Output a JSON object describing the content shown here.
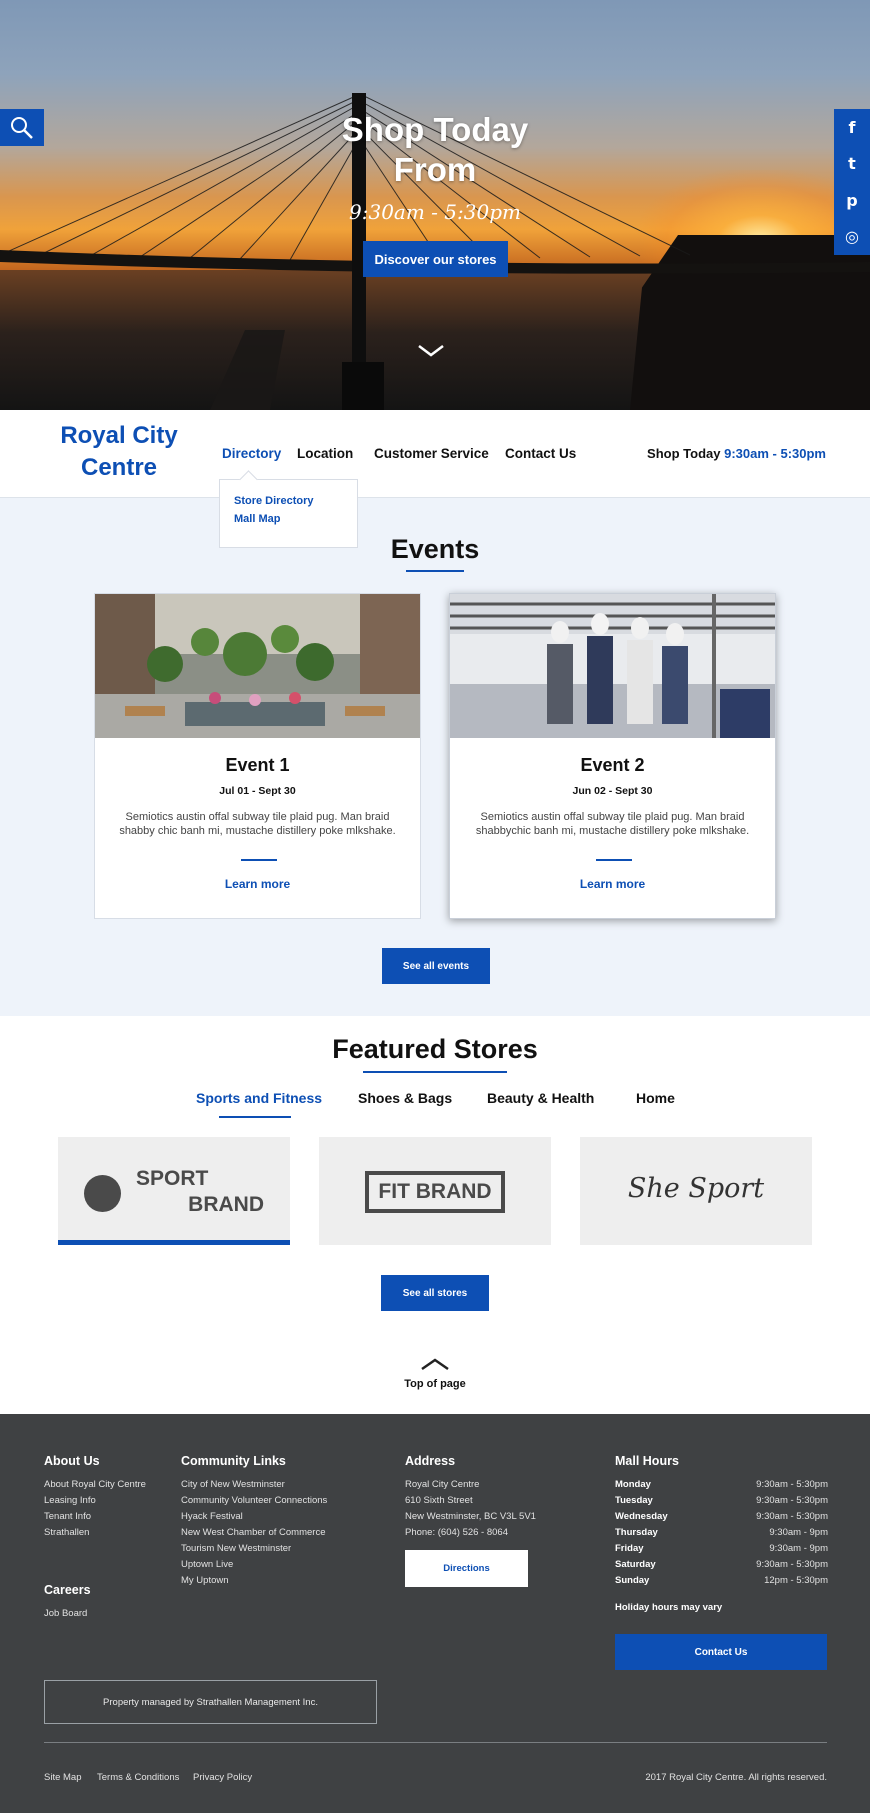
{
  "hero": {
    "title_line1": "Shop Today",
    "title_line2": "From",
    "hours": "9:30am - 5:30pm",
    "cta": "Discover our stores"
  },
  "icons": {
    "search": "search-icon",
    "social": [
      "facebook-icon",
      "twitter-icon",
      "pinterest-icon",
      "instagram-icon"
    ],
    "scroll_down": "chevron-down-icon",
    "top": "chevron-up-icon"
  },
  "social_glyphs": [
    "f",
    "t",
    "p",
    "◎"
  ],
  "header": {
    "logo_line1": "Royal City",
    "logo_line2": "Centre",
    "nav": [
      "Directory",
      "Location",
      "Customer Service",
      "Contact Us"
    ],
    "shop_label": "Shop Today",
    "shop_hours": "9:30am - 5:30pm",
    "dropdown": [
      "Store Directory",
      "Mall Map"
    ]
  },
  "events": {
    "title": "Events",
    "items": [
      {
        "name": "Event 1",
        "date": "Jul 01 - Sept 30",
        "desc": "Semiotics austin offal subway tile plaid pug. Man braid shabby chic banh mi, mustache distillery poke mlkshake.",
        "link": "Learn more"
      },
      {
        "name": "Event 2",
        "date": "Jun 02 - Sept 30",
        "desc": "Semiotics austin offal subway tile plaid pug. Man braid shabbychic banh mi, mustache distillery poke mlkshake.",
        "link": "Learn more"
      }
    ],
    "all_button": "See all events"
  },
  "featured": {
    "title": "Featured Stores",
    "tabs": [
      "Sports and Fitness",
      "Shoes & Bags",
      "Beauty & Health",
      "Home"
    ],
    "stores": [
      {
        "line1": "SPORT",
        "line2": "BRAND"
      },
      {
        "name": "FIT BRAND"
      },
      {
        "name": "She Sport"
      }
    ],
    "all_button": "See all stores",
    "top_link": "Top of page"
  },
  "footer": {
    "about_title": "About Us",
    "about_links": [
      "About Royal City Centre",
      "Leasing Info",
      "Tenant Info",
      "Strathallen"
    ],
    "careers_title": "Careers",
    "careers_links": [
      "Job Board"
    ],
    "community_title": "Community Links",
    "community_links": [
      "City of New Westminster",
      "Community Volunteer Connections",
      "Hyack Festival",
      "New West Chamber of Commerce",
      "Tourism New Westminster",
      "Uptown Live",
      "My Uptown"
    ],
    "address_title": "Address",
    "address_lines": [
      "Royal City Centre",
      "610 Sixth Street",
      "New Westminster, BC V3L 5V1",
      "Phone: (604) 526 - 8064"
    ],
    "directions": "Directions",
    "hours_title": "Mall Hours",
    "hours": [
      {
        "day": "Monday",
        "time": "9:30am - 5:30pm"
      },
      {
        "day": "Tuesday",
        "time": "9:30am - 5:30pm"
      },
      {
        "day": "Wednesday",
        "time": "9:30am - 5:30pm"
      },
      {
        "day": "Thursday",
        "time": "9:30am - 9pm"
      },
      {
        "day": "Friday",
        "time": "9:30am - 9pm"
      },
      {
        "day": "Saturday",
        "time": "9:30am - 5:30pm"
      },
      {
        "day": "Sunday",
        "time": "12pm - 5:30pm"
      }
    ],
    "holiday_note": "Holiday hours may vary",
    "contact_button": "Contact Us",
    "managed": "Property managed by Strathallen Management Inc.",
    "bottom_links": [
      "Site Map",
      "Terms & Conditions",
      "Privacy Policy"
    ],
    "copyright": "2017 Royal City Centre. All rights reserved."
  },
  "colors": {
    "accent": "#0d4fb4",
    "footer_bg": "#3f4143",
    "events_bg": "#eef3fa"
  }
}
